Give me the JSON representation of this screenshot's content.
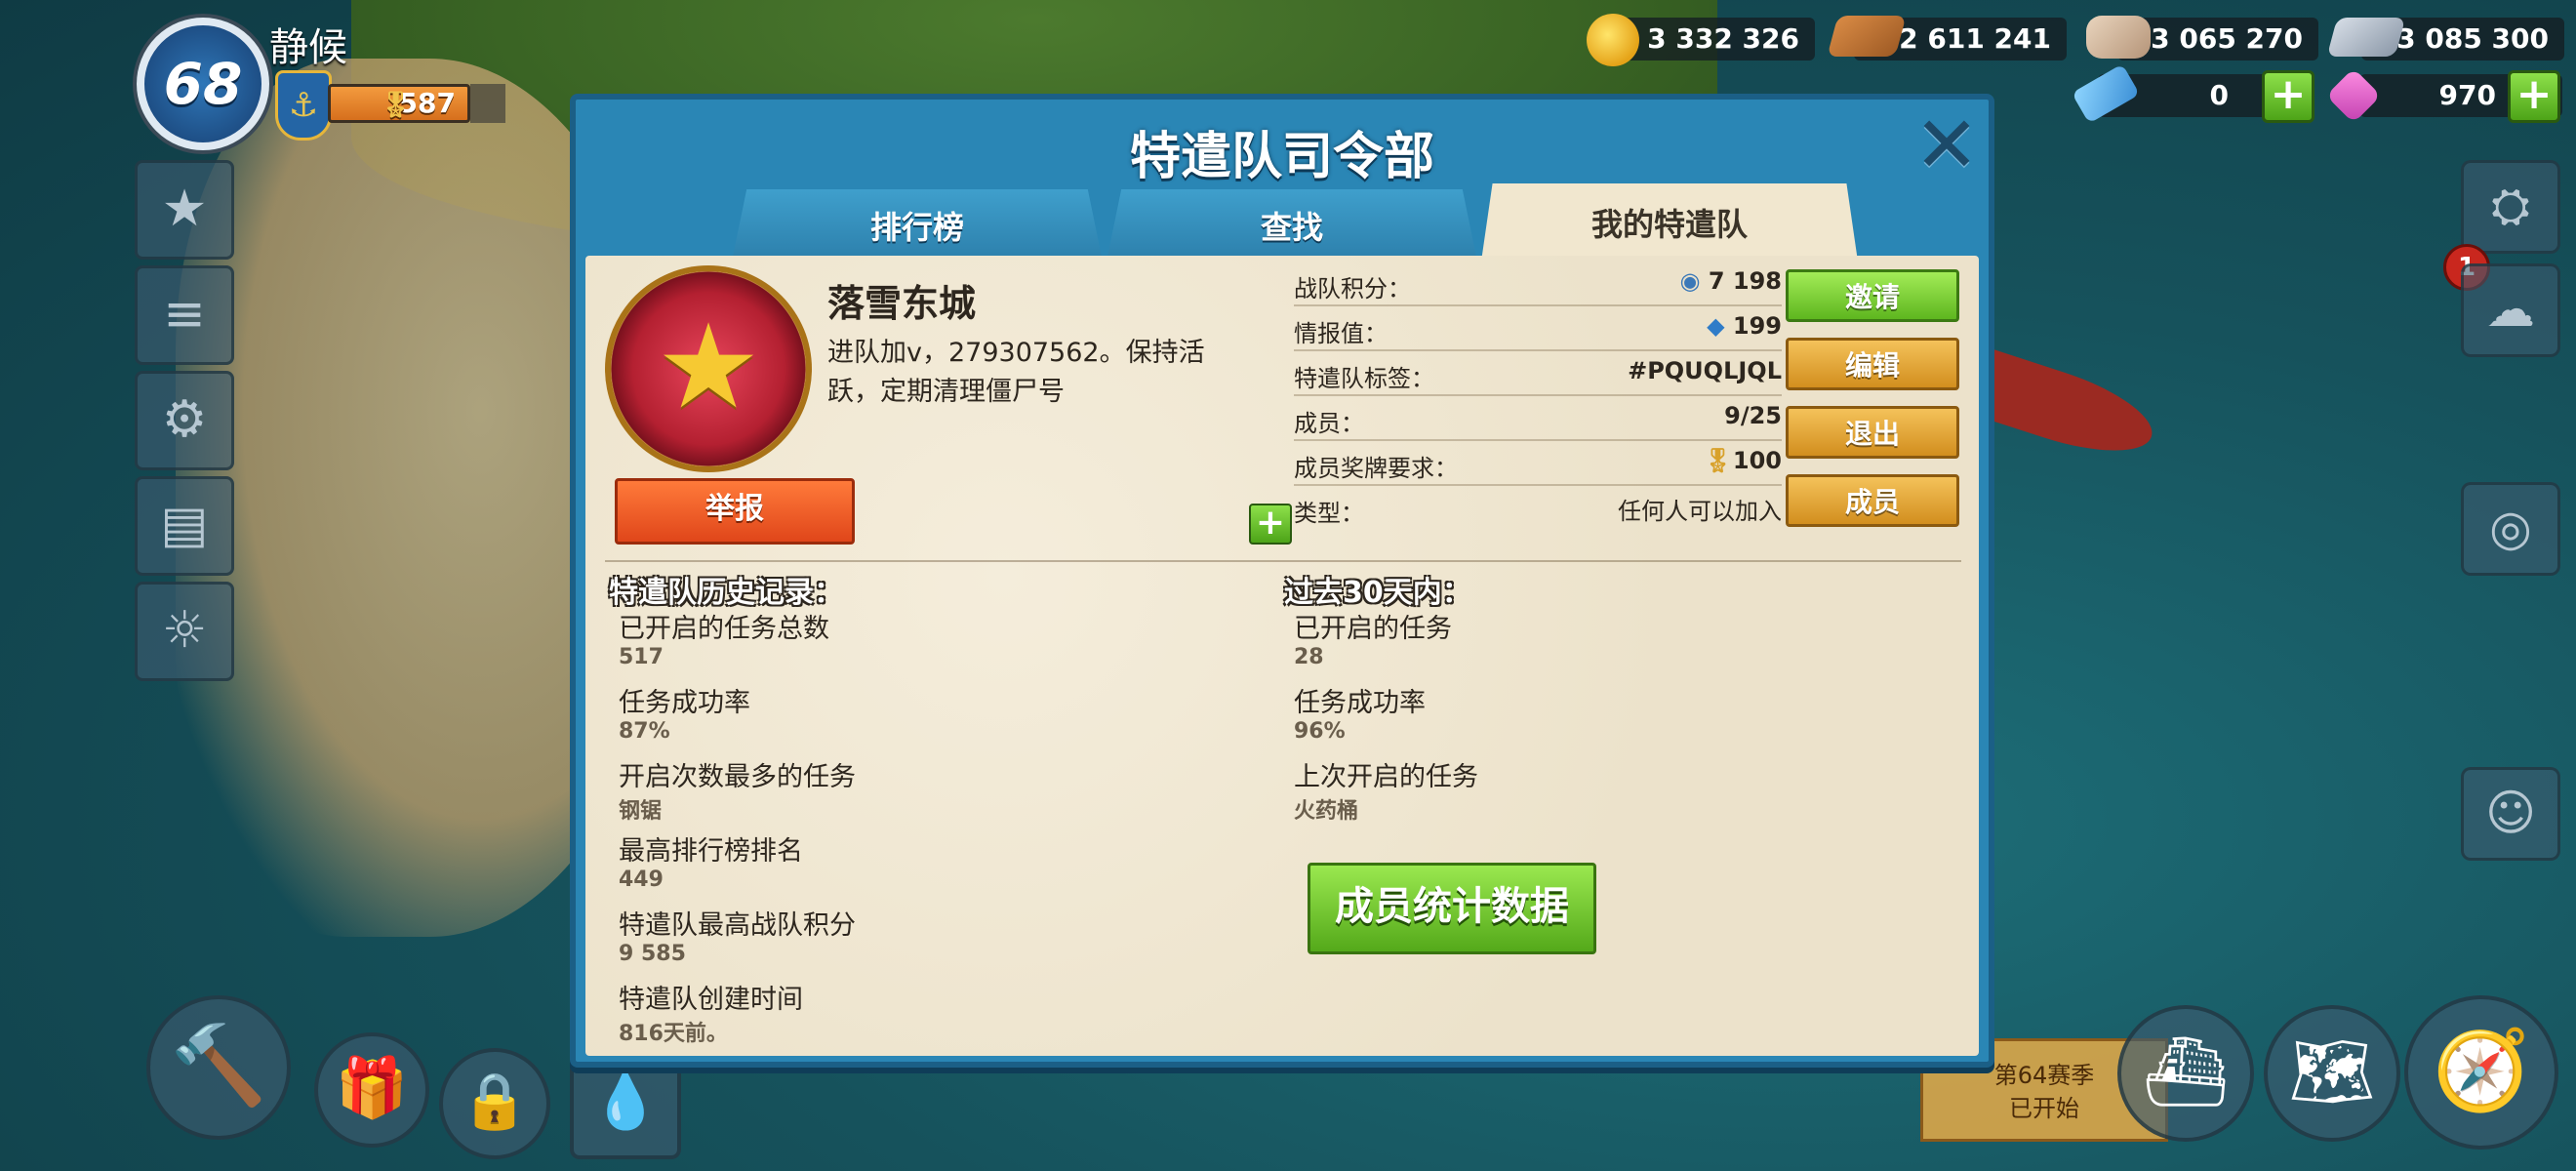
{
  "player": {
    "level": "68",
    "name": "静候",
    "medals": "587"
  },
  "resources": {
    "gold": "3 332 326",
    "wood": "2 611 241",
    "stone": "3 065 270",
    "iron": "3 085 300",
    "diamonds": "0",
    "gems": "970"
  },
  "notification_count": "1",
  "season": {
    "line1": "第64赛季",
    "line2": "已开始"
  },
  "dialog": {
    "title": "特遣队司令部",
    "tabs": [
      {
        "label": "排行榜"
      },
      {
        "label": "查找"
      },
      {
        "label": "我的特遣队"
      }
    ],
    "task_force": {
      "name": "落雪东城",
      "description": "进队加v，279307562。保持活跃，定期清理僵尸号",
      "report_label": "举报"
    },
    "stats": [
      {
        "label": "战队积分：",
        "value": "7 198"
      },
      {
        "label": "情报值：",
        "value": "199"
      },
      {
        "label": "特遣队标签：",
        "value": "#PQUQLJQL"
      },
      {
        "label": "成员：",
        "value": "9/25"
      },
      {
        "label": "成员奖牌要求：",
        "value": "100"
      },
      {
        "label": "类型：",
        "value": "任何人可以加入"
      }
    ],
    "actions": {
      "invite": "邀请",
      "edit": "编辑",
      "leave": "退出",
      "members": "成员"
    },
    "history": {
      "header": "特遣队历史记录：",
      "items": [
        {
          "label": "已开启的任务总数",
          "value": "517"
        },
        {
          "label": "任务成功率",
          "value": "87%"
        },
        {
          "label": "开启次数最多的任务",
          "value": "钢锯"
        },
        {
          "label": "最高排行榜排名",
          "value": "449"
        },
        {
          "label": "特遣队最高战队积分",
          "value": "9 585"
        },
        {
          "label": "特遣队创建时间",
          "value": "816天前。"
        }
      ]
    },
    "recent": {
      "header": "过去30天内：",
      "items": [
        {
          "label": "已开启的任务",
          "value": "28"
        },
        {
          "label": "任务成功率",
          "value": "96%"
        },
        {
          "label": "上次开启的任务",
          "value": "火药桶"
        }
      ]
    },
    "member_stats_label": "成员统计数据"
  }
}
